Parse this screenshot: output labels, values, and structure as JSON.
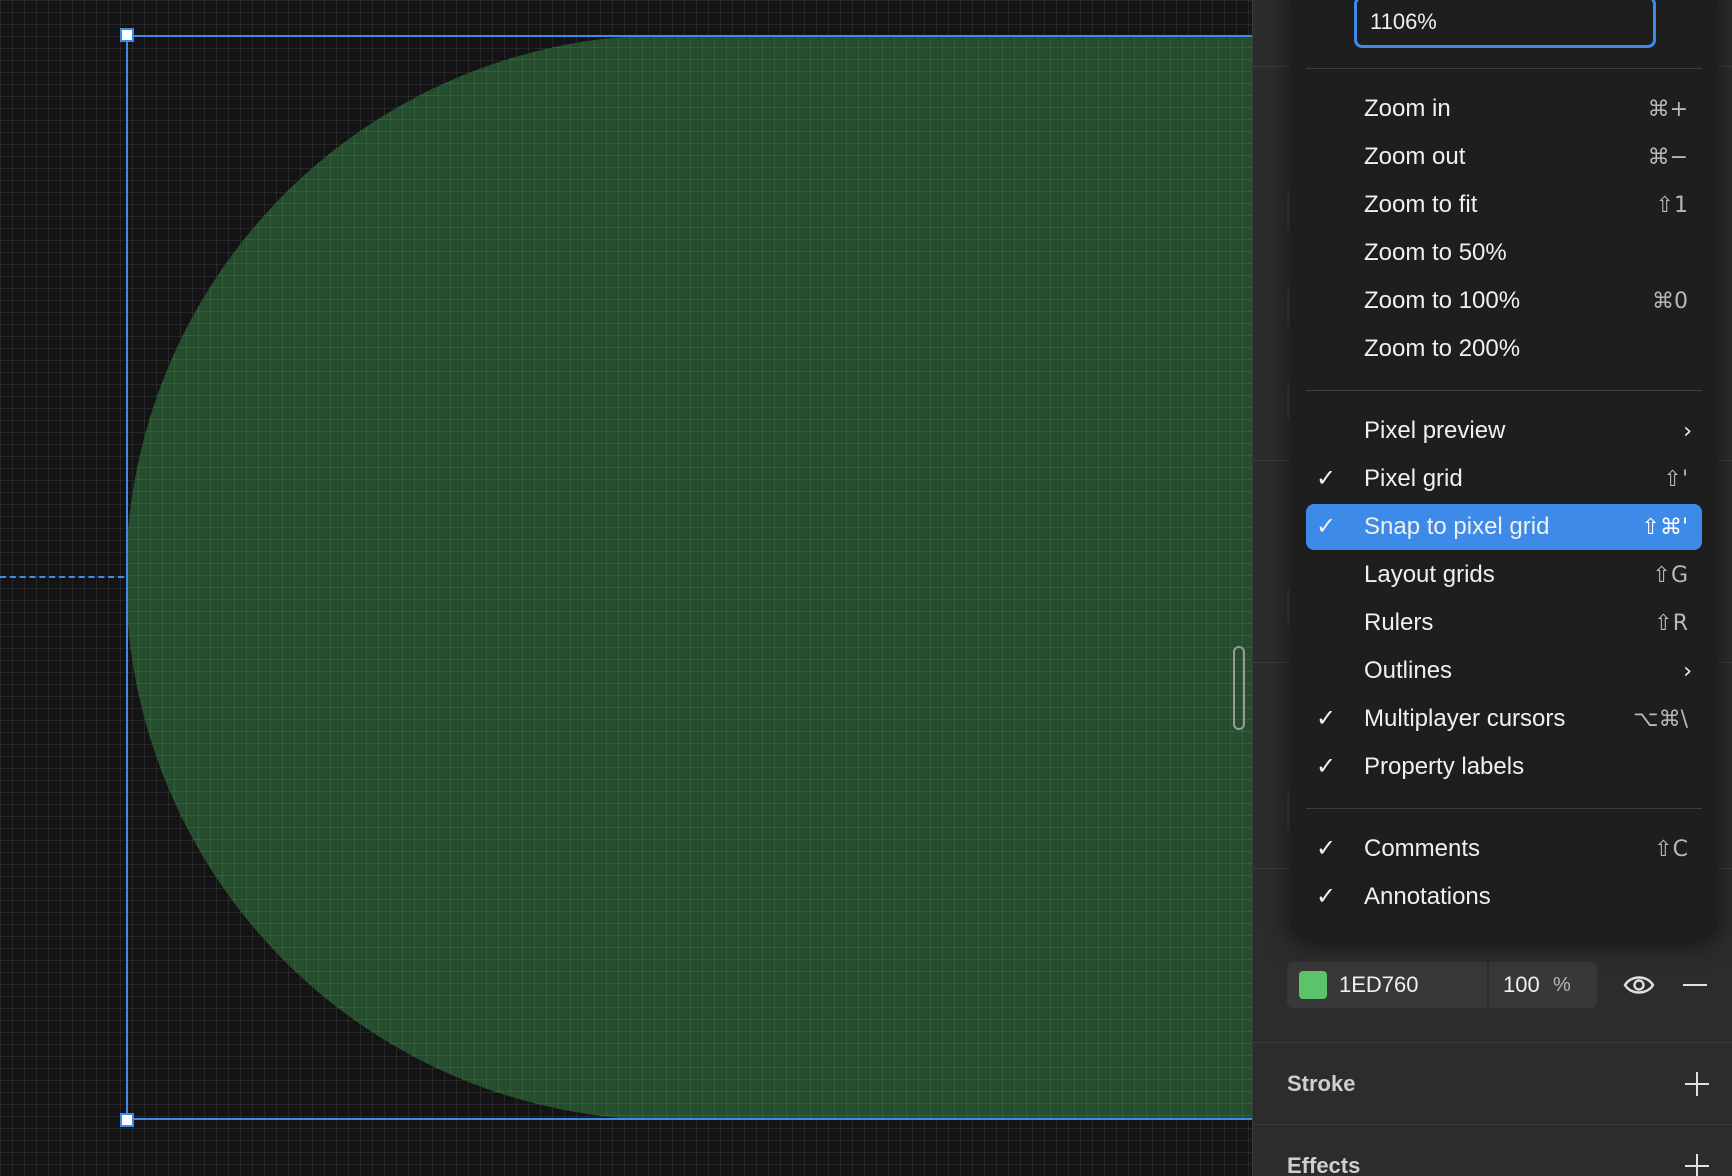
{
  "canvas": {
    "shape_fill": "#264d2e",
    "selection_color": "#3d8ae8"
  },
  "zoom_menu": {
    "zoom_value": "1106%",
    "items": [
      {
        "label": "Zoom in",
        "shortcut": "⌘+",
        "checked": false
      },
      {
        "label": "Zoom out",
        "shortcut": "⌘−",
        "checked": false
      },
      {
        "label": "Zoom to fit",
        "shortcut": "⇧1",
        "checked": false
      },
      {
        "label": "Zoom to 50%",
        "shortcut": "",
        "checked": false
      },
      {
        "label": "Zoom to 100%",
        "shortcut": "⌘0",
        "checked": false
      },
      {
        "label": "Zoom to 200%",
        "shortcut": "",
        "checked": false
      },
      {
        "label": "Pixel preview",
        "shortcut": "",
        "submenu": true,
        "checked": false
      },
      {
        "label": "Pixel grid",
        "shortcut": "⇧'",
        "checked": true
      },
      {
        "label": "Snap to pixel grid",
        "shortcut": "⇧⌘'",
        "checked": true,
        "highlighted": true
      },
      {
        "label": "Layout grids",
        "shortcut": "⇧G",
        "checked": false
      },
      {
        "label": "Rulers",
        "shortcut": "⇧R",
        "checked": false
      },
      {
        "label": "Outlines",
        "shortcut": "",
        "submenu": true,
        "checked": false
      },
      {
        "label": "Multiplayer cursors",
        "shortcut": "⌥⌘\\",
        "checked": true
      },
      {
        "label": "Property labels",
        "shortcut": "",
        "checked": true
      },
      {
        "label": "Comments",
        "shortcut": "⇧C",
        "checked": true
      },
      {
        "label": "Annotations",
        "shortcut": "",
        "checked": true
      }
    ],
    "check_glyph": "✓",
    "chevron_glyph": "›"
  },
  "panel": {
    "fill": {
      "hex": "1ED760",
      "swatch_color": "#5cc36a",
      "opacity": "100",
      "percent_sign": "%"
    },
    "stroke_title": "Stroke",
    "effects_title": "Effects"
  }
}
